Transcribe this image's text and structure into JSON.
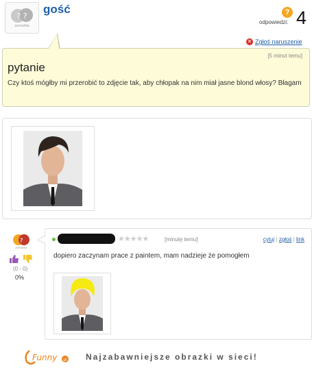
{
  "user": {
    "name": "gość",
    "avatar_caption": "zamotka"
  },
  "answers": {
    "label": "odpowiedzi:",
    "count": "4"
  },
  "report": {
    "label": "Zgłoś naruszenie"
  },
  "question": {
    "time": "[5 minut temu]",
    "title": "pytanie",
    "text": "Czy ktoś mógłby mi przerobić to zdjęcie tak, aby chłopak na nim miał jasne blond włosy? Błagam"
  },
  "answer": {
    "stars": "★★★★★",
    "time": "[minutę temu]",
    "links": {
      "quote": "cytuj",
      "report": "zgłoś",
      "link": "link"
    },
    "text": "dopiero zaczynam prace z paintem, mam nadzieje że pomogłem",
    "votes": {
      "score": "(0 - 0)",
      "percent": "0%"
    }
  },
  "footer": {
    "logo": "Funny",
    "slogan": "Najzabawniejsze obrazki w sieci!"
  },
  "colors": {
    "link": "#1f5fa8",
    "question_bg": "#fdfbd8",
    "wig": "#f5ea11"
  }
}
